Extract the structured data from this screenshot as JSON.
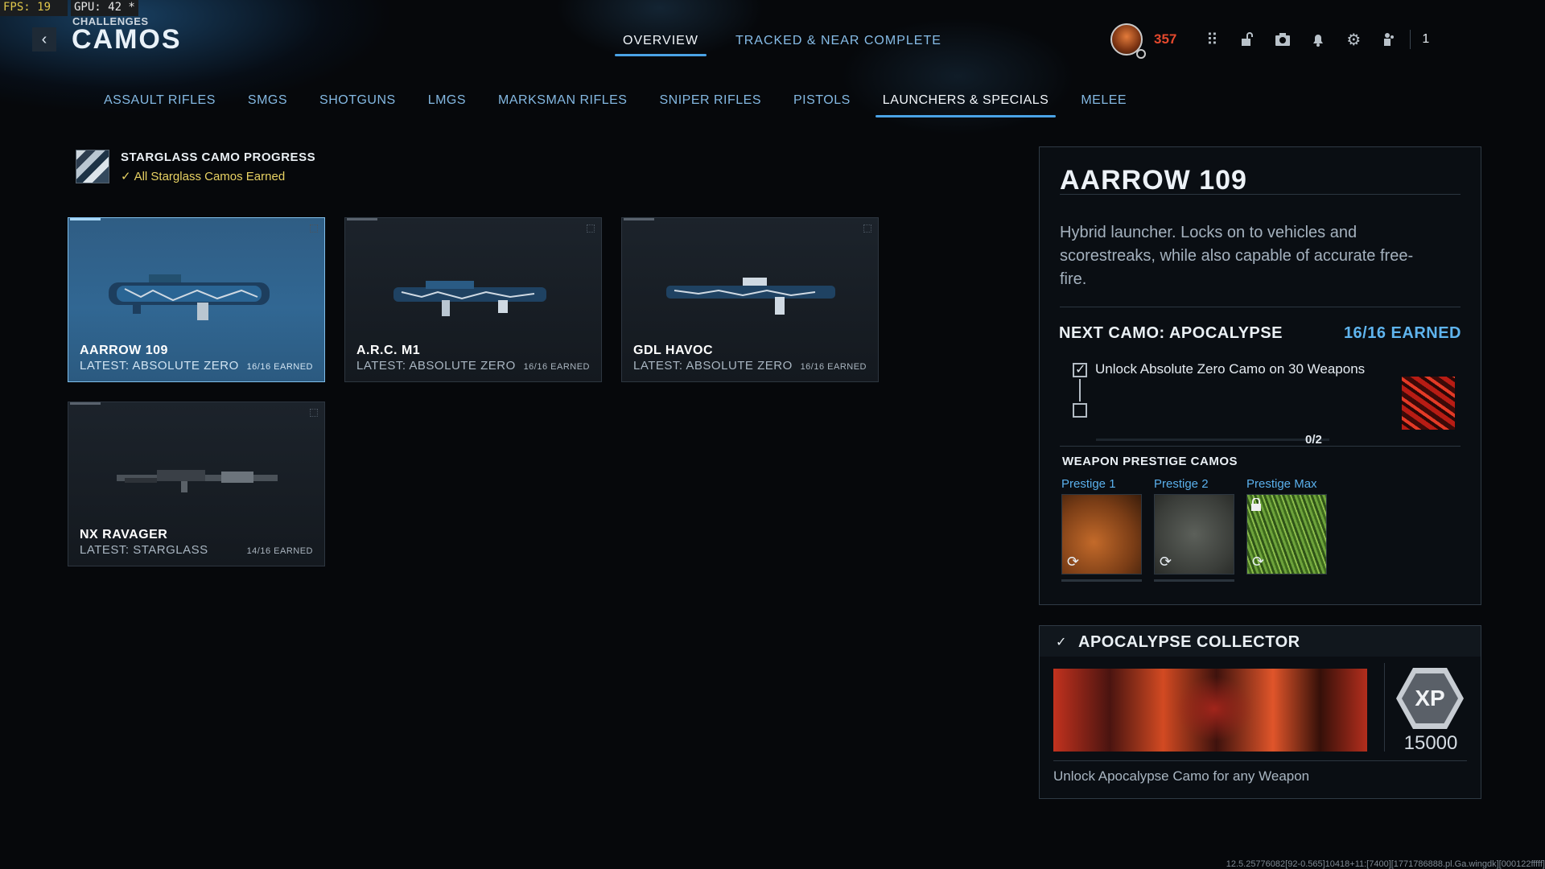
{
  "hud": {
    "fps": "FPS:  19",
    "gpu": "GPU: 42 *"
  },
  "header": {
    "breadcrumb": "CHALLENGES",
    "title": "CAMOS",
    "tabs": [
      {
        "label": "OVERVIEW",
        "active": true
      },
      {
        "label": "TRACKED & NEAR COMPLETE",
        "active": false
      }
    ],
    "rank_value": "357",
    "party_count": "1"
  },
  "categories": [
    {
      "label": "ASSAULT RIFLES",
      "active": false
    },
    {
      "label": "SMGS",
      "active": false
    },
    {
      "label": "SHOTGUNS",
      "active": false
    },
    {
      "label": "LMGS",
      "active": false
    },
    {
      "label": "MARKSMAN RIFLES",
      "active": false
    },
    {
      "label": "SNIPER RIFLES",
      "active": false
    },
    {
      "label": "PISTOLS",
      "active": false
    },
    {
      "label": "LAUNCHERS & SPECIALS",
      "active": true
    },
    {
      "label": "MELEE",
      "active": false
    }
  ],
  "progress": {
    "title": "STARGLASS CAMO PROGRESS",
    "status": "All Starglass Camos Earned"
  },
  "weapons": [
    {
      "name": "AARROW 109",
      "latest": "LATEST: ABSOLUTE ZERO",
      "earned": "16/16 EARNED",
      "selected": true
    },
    {
      "name": "A.R.C. M1",
      "latest": "LATEST: ABSOLUTE ZERO",
      "earned": "16/16 EARNED",
      "selected": false
    },
    {
      "name": "GDL HAVOC",
      "latest": "LATEST: ABSOLUTE ZERO",
      "earned": "16/16 EARNED",
      "selected": false
    },
    {
      "name": "NX RAVAGER",
      "latest": "LATEST: STARGLASS",
      "earned": "14/16 EARNED",
      "selected": false
    }
  ],
  "detail": {
    "title": "AARROW 109",
    "description": "Hybrid launcher. Locks on to vehicles and scorestreaks, while also capable of accurate free-fire.",
    "next_camo": "NEXT CAMO: APOCALYPSE",
    "earned": "16/16 EARNED",
    "challenge": "Unlock Absolute Zero Camo on 30 Weapons",
    "challenge_progress": "0/2",
    "prestige_heading": "WEAPON PRESTIGE CAMOS",
    "prestige": [
      {
        "label": "Prestige 1",
        "locked": false
      },
      {
        "label": "Prestige 2",
        "locked": false
      },
      {
        "label": "Prestige Max",
        "locked": true
      }
    ]
  },
  "collector": {
    "title": "APOCALYPSE COLLECTOR",
    "xp": "15000",
    "xp_badge": "XP",
    "description": "Unlock Apocalypse Camo for any Weapon"
  },
  "build_string": "12.5.25776082[92-0.565]10418+11:[7400][1771786888.pl.Ga.wingdk][000122fffff]",
  "colors": {
    "accent": "#4aa3e6",
    "rank": "#e4492d",
    "earned_yellow": "#e8d263",
    "selected_card": "#316793"
  }
}
